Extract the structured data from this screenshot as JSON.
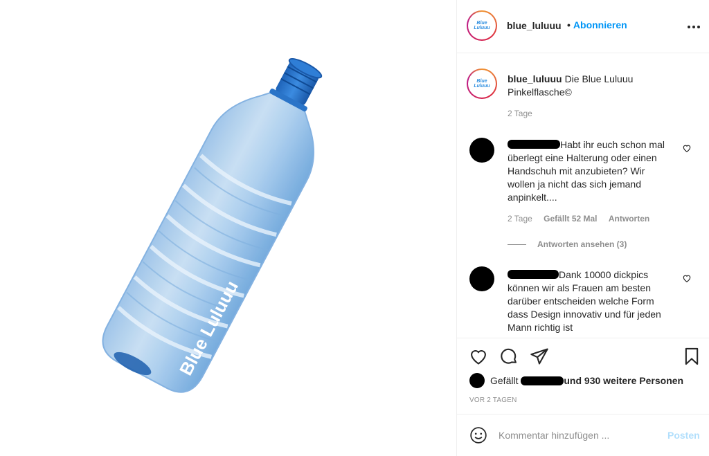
{
  "post": {
    "image": {
      "bottle_label": "Blue Luluuu",
      "bottle_color": "#3f8fd8"
    },
    "header": {
      "avatar_logo_line1": "Blue",
      "avatar_logo_line2": "Luluuu",
      "username": "blue_luluuu",
      "follow_dot": "•",
      "follow_label": "Abonnieren",
      "more_icon": "more-horizontal-icon"
    },
    "caption": {
      "username": "blue_luluuu",
      "text": "Die Blue Luluuu Pinkelflasche©",
      "time": "2 Tage"
    },
    "comments": [
      {
        "text": "Habt ihr euch schon mal überlegt eine Halterung oder einen Handschuh mit anzubieten? Wir wollen ja nicht das sich jemand anpinkelt....",
        "time": "2 Tage",
        "likes": "Gefällt 52 Mal",
        "reply_label": "Antworten",
        "view_replies": "Antworten ansehen (3)"
      },
      {
        "text": "Dank 10000 dickpics können wir als Frauen am besten darüber entscheiden welche Form dass Design innovativ und für jeden Mann richtig ist"
      }
    ],
    "likes": {
      "prefix": "Gefällt",
      "suffix": "und 930 weitere Personen"
    },
    "date": "VOR 2 TAGEN",
    "comment_box": {
      "placeholder": "Kommentar hinzufügen ...",
      "post_label": "Posten"
    },
    "colors": {
      "accent": "#0095f6",
      "post_disabled": "#b2dffc",
      "muted": "#8e8e8e",
      "text": "#262626"
    }
  }
}
